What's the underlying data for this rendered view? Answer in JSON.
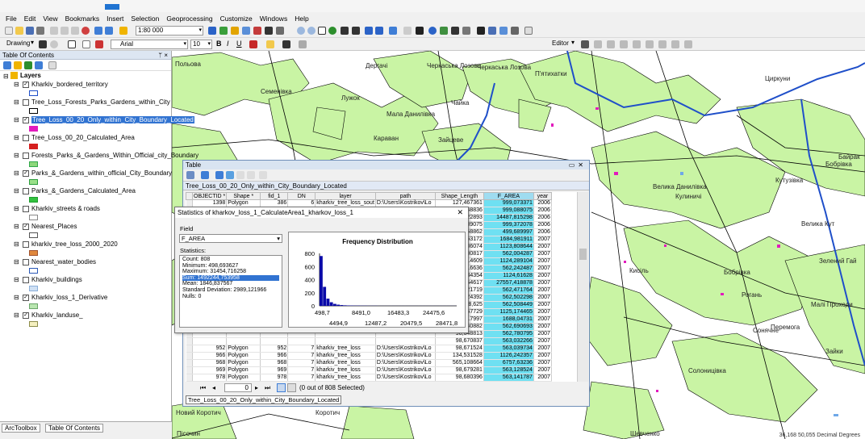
{
  "menu": [
    "File",
    "Edit",
    "View",
    "Bookmarks",
    "Insert",
    "Selection",
    "Geoprocessing",
    "Customize",
    "Windows",
    "Help"
  ],
  "toolbar": {
    "scale": "1:80 000",
    "drawing_label": "Drawing",
    "font_name": "Arial",
    "font_size": "10",
    "editor_label": "Editor"
  },
  "toc": {
    "title": "Table Of Contents",
    "root": "Layers",
    "layers": [
      {
        "name": "Kharkiv_bordered_territory",
        "checked": true,
        "symbol": "#1f4fc9",
        "fill": "#ffffff"
      },
      {
        "name": "Tree_Loss_Forests_Parks_Gardens_within_City",
        "checked": false,
        "symbol": "#000000",
        "fill": "#ffffff"
      },
      {
        "name": "Tree_Loss_00_20_Only_within_City_Boundary_Located",
        "checked": true,
        "symbol": "#e21bbd",
        "fill": "#e21bbd",
        "selected": true
      },
      {
        "name": "Tree_Loss_00_20_Calculated_Area",
        "checked": false,
        "symbol": "#d51f1f",
        "fill": "#d51f1f"
      },
      {
        "name": "Forests_Parks_&_Gardens_Within_Official_city_Boundary",
        "checked": false,
        "symbol": "#31a84a",
        "fill": "#8dd77b"
      },
      {
        "name": "Parks_&_Gardens_within_official_City_Boundary",
        "checked": true,
        "symbol": "#2c9e3c",
        "fill": "#9be08a"
      },
      {
        "name": "Parks_&_Gardens_Calculated_Area",
        "checked": false,
        "symbol": "#1e9e2e",
        "fill": "#33c13f"
      },
      {
        "name": "Kharkiv_streets & roads",
        "checked": false,
        "symbol": "#888888",
        "fill": "#ffffff"
      },
      {
        "name": "Nearest_Places",
        "checked": true,
        "symbol": "#555555",
        "fill": "#ffffff"
      },
      {
        "name": "kharkiv_tree_loss_2000_2020",
        "checked": false,
        "symbol": "#a0522d",
        "fill": "#e0883d"
      },
      {
        "name": "Nearest_water_bodies",
        "checked": false,
        "symbol": "#2a58b6",
        "fill": "#ffffff"
      },
      {
        "name": "Kharkiv_buildings",
        "checked": false,
        "symbol": "#8aaed8",
        "fill": "#cfe0f4"
      },
      {
        "name": "Kharkiv_loss_1_Derivative",
        "checked": true,
        "symbol": "#6aa56a",
        "fill": "#b9e6b0"
      },
      {
        "name": "Kharkiv_landuse_",
        "checked": true,
        "symbol": "#8c8c4a",
        "fill": "#f5f0c0"
      }
    ],
    "tabs": [
      "ArcToolbox",
      "Table Of Contents"
    ]
  },
  "map": {
    "labels": [
      "Польова",
      "Семенівка",
      "Дергачі",
      "Черкаська Лозова",
      "Черкаська Лозова",
      "П'ятихатки",
      "Циркуни",
      "Лужок",
      "Мала Данилівка",
      "Чайка",
      "Караван",
      "Зайцеве",
      "Велика Данилівка",
      "Бобрівка",
      "Байрак",
      "Кутузівка",
      "Велика Кут",
      "Кулиничі",
      "Кисіль",
      "Бобрівка",
      "Малі Проходи",
      "Рогань",
      "Зелений Гай",
      "Солоницівка",
      "Коротич",
      "Новий Коротич",
      "Сонячне",
      "Перемога",
      "Зайки",
      "Шевченко",
      "Пісочин"
    ],
    "coords": "36,168  50,055 Decimal Degrees"
  },
  "table_window": {
    "title": "Table",
    "layer": "Tree_Loss_00_20_Only_within_City_Boundary_Located",
    "columns": [
      "OBJECTID *",
      "Shape *",
      "fid_1",
      "DN",
      "layer",
      "path",
      "Shape_Length",
      "F_AREA",
      "year"
    ],
    "rows": [
      [
        "1398",
        "Polygon",
        "386",
        "6",
        "kharkiv_tree_loss_sout",
        "D:\\Users\\Kostrikov\\Lo",
        "127,467361",
        "999,073371",
        "2006"
      ],
      [
        "",
        "",
        "",
        "",
        "",
        "",
        "127,48836",
        "999,088075",
        "2006"
      ],
      [
        "",
        "",
        "",
        "",
        "",
        "",
        "585,22893",
        "14487,815298",
        "2006"
      ],
      [
        "",
        "",
        "",
        "",
        "",
        "",
        "127,489075",
        "999,372078",
        "2006"
      ],
      [
        "",
        "",
        "",
        "",
        "",
        "",
        "91,558862",
        "499,689997",
        "2006"
      ],
      [
        "",
        "",
        "",
        "",
        "",
        "",
        "170,163172",
        "1684,981911",
        "2007"
      ],
      [
        "",
        "",
        "",
        "",
        "",
        "",
        "134,386074",
        "1123,808644",
        "2007"
      ],
      [
        "",
        "",
        "",
        "",
        "",
        "",
        "98,580817",
        "562,004287",
        "2007"
      ],
      [
        "",
        "",
        "",
        "",
        "",
        "",
        "134,414609",
        "1124,289104",
        "2007"
      ],
      [
        "",
        "",
        "",
        "",
        "",
        "",
        "98,616636",
        "562,242487",
        "2007"
      ],
      [
        "",
        "",
        "",
        "",
        "",
        "",
        "134,434354",
        "1124,61628",
        "2007"
      ],
      [
        "",
        "",
        "",
        "",
        "",
        "",
        "966,154617",
        "27557,418878",
        "2007"
      ],
      [
        "",
        "",
        "",
        "",
        "",
        "",
        "98,821719",
        "562,471764",
        "2007"
      ],
      [
        "",
        "",
        "",
        "",
        "",
        "",
        "98,624392",
        "562,502298",
        "2007"
      ],
      [
        "",
        "",
        "",
        "",
        "",
        "",
        "98,625",
        "562,508449",
        "2007"
      ],
      [
        "",
        "",
        "",
        "",
        "",
        "",
        "134,467729",
        "1125,174465",
        "2007"
      ],
      [
        "",
        "",
        "",
        "",
        "",
        "",
        "170,317997",
        "1688,04731",
        "2007"
      ],
      [
        "",
        "",
        "",
        "",
        "",
        "",
        "98,640882",
        "562,690693",
        "2007"
      ],
      [
        "",
        "",
        "",
        "",
        "",
        "",
        "98,648813",
        "562,780795",
        "2007"
      ],
      [
        "",
        "",
        "",
        "",
        "",
        "",
        "98,670837",
        "563,032266",
        "2007"
      ],
      [
        "952",
        "Polygon",
        "952",
        "7",
        "kharkiv_tree_loss",
        "D:\\Users\\Kostrikov\\Lo",
        "98,671524",
        "563,039734",
        "2007"
      ],
      [
        "966",
        "Polygon",
        "966",
        "7",
        "kharkiv_tree_loss",
        "D:\\Users\\Kostrikov\\Lo",
        "134,531528",
        "1126,242357",
        "2007"
      ],
      [
        "968",
        "Polygon",
        "968",
        "7",
        "kharkiv_tree_loss",
        "D:\\Users\\Kostrikov\\Lo",
        "565,108664",
        "6757,63236",
        "2007"
      ],
      [
        "969",
        "Polygon",
        "969",
        "7",
        "kharkiv_tree_loss",
        "D:\\Users\\Kostrikov\\Lo",
        "98,679281",
        "563,128524",
        "2007"
      ],
      [
        "978",
        "Polygon",
        "978",
        "7",
        "kharkiv_tree_loss",
        "D:\\Users\\Kostrikov\\Lo",
        "98,680396",
        "563,141787",
        "2007"
      ],
      [
        "983",
        "Polygon",
        "983",
        "7",
        "kharkiv_tree_loss",
        "D:\\Users\\Kostrikov\\Lo",
        "98,681613",
        "563,155306",
        "2007"
      ],
      [
        "1008",
        "Polygon",
        "1008",
        "7",
        "kharkiv_tree_loss",
        "D:\\Users\\Kostrikov\\Lo",
        "134,548024",
        "1126,518427",
        "2007"
      ]
    ],
    "record": "0",
    "status": "(0 out of 808 Selected)",
    "tab": "Tree_Loss_00_20_Only_within_City_Boundary_Located"
  },
  "stats": {
    "title": "Statistics of kharkov_loss_1_CalculateArea1_kharkov_loss_1",
    "field_label": "Field",
    "field_value": "F_AREA",
    "statistics_label": "Statistics:",
    "lines": [
      "Count:  808",
      "Minimum: 498,693627",
      "Maximum: 31454,716258",
      "Sum:    1492244,753958",
      "Mean:   1846,837567",
      "Standard Deviation: 2989,121966",
      "Nulls:  0"
    ]
  },
  "chart_data": {
    "type": "bar",
    "title": "Frequency Distribution",
    "yticks": [
      "0",
      "200",
      "400",
      "600",
      "800"
    ],
    "ylim": [
      0,
      800
    ],
    "xticks_top": [
      "498,7",
      "8491,0",
      "16483,3",
      "24475,6"
    ],
    "xticks_bottom": [
      "4494,9",
      "12487,2",
      "20479,5",
      "28471,8"
    ],
    "values": [
      760,
      290,
      110,
      55,
      30,
      18,
      12,
      8,
      6,
      5,
      4,
      4,
      3,
      3,
      2,
      2,
      2,
      1,
      1,
      1,
      1,
      1,
      1,
      1,
      1,
      1,
      1,
      1,
      1,
      1,
      1,
      1,
      1,
      1,
      1,
      1,
      1,
      1,
      1,
      1
    ],
    "color": "#0a0aa8"
  }
}
